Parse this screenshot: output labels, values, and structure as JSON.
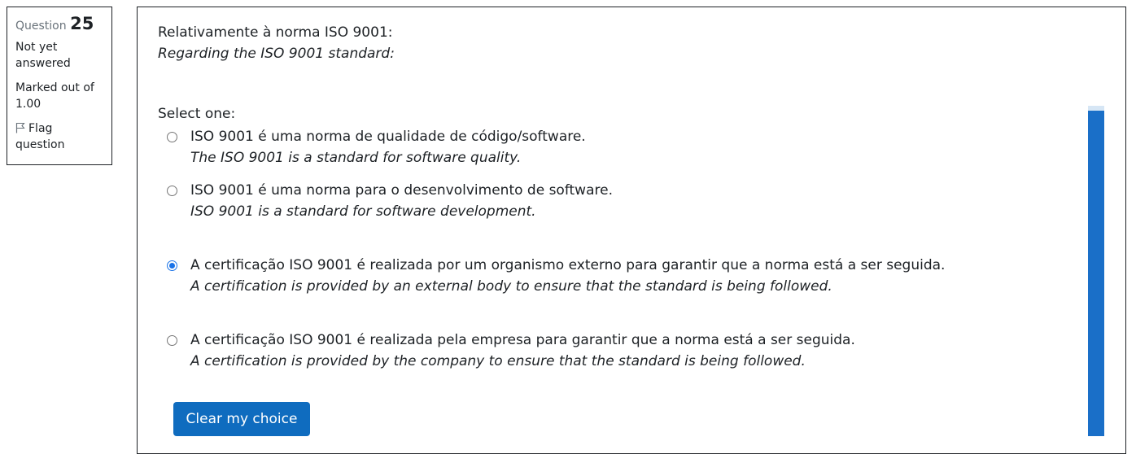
{
  "info": {
    "question_label": "Question",
    "question_number": "25",
    "state": "Not yet answered",
    "grade": "Marked out of 1.00",
    "flag_label": "Flag question"
  },
  "question": {
    "text_pt": "Relativamente à norma ISO 9001:",
    "text_en": "Regarding the ISO 9001 standard:",
    "prompt": "Select one:",
    "answers": [
      {
        "pt": "ISO 9001 é uma norma de qualidade de código/software.",
        "en": "The ISO 9001 is a standard for software quality.",
        "selected": false
      },
      {
        "pt": "ISO 9001 é uma norma para o desenvolvimento de software.",
        "en": "ISO 9001 is a standard for software development.",
        "selected": false
      },
      {
        "pt": "A certificação ISO 9001 é realizada por um organismo externo para garantir que a norma está a ser seguida.",
        "en": "A certification is provided by an external body to ensure that the standard is being followed.",
        "selected": true
      },
      {
        "pt": "A certificação ISO 9001 é realizada pela empresa para garantir que a norma está a ser seguida.",
        "en": "A certification is provided by the company to ensure that the standard is being followed.",
        "selected": false
      }
    ],
    "clear_label": "Clear my choice"
  },
  "colors": {
    "primary_button": "#0f6cbf",
    "radio_selected": "#1a73e8",
    "scrollbar_thumb": "#1a6fc8"
  }
}
